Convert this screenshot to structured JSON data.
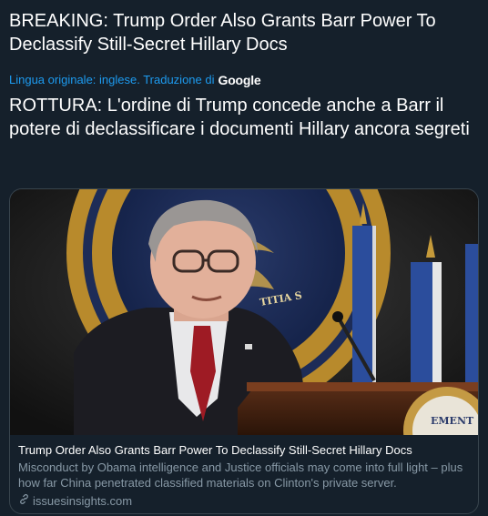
{
  "tweet": {
    "original_text": "BREAKING: Trump Order Also Grants Barr Power To Declassify Still-Secret Hillary Docs",
    "translation_note": "Lingua originale: inglese. Traduzione di",
    "translation_provider": "Google",
    "translated_text": "ROTTURA: L'ordine di Trump concede anche a Barr il potere di declassificare i documenti Hillary ancora segreti"
  },
  "card": {
    "image_icon": "photo-of-speaker-at-podium",
    "title": "Trump Order Also Grants Barr Power To Declassify Still-Secret Hillary Docs",
    "description": "Misconduct by Obama intelligence and Justice officials may come into full light – plus how far China penetrated classified materials on Clinton's private server.",
    "domain": "issuesinsights.com",
    "link_icon": "link-icon"
  },
  "colors": {
    "background": "#15202b",
    "text": "#ffffff",
    "secondary": "#8899a6",
    "link": "#1d9bf0",
    "border": "#38444d"
  }
}
